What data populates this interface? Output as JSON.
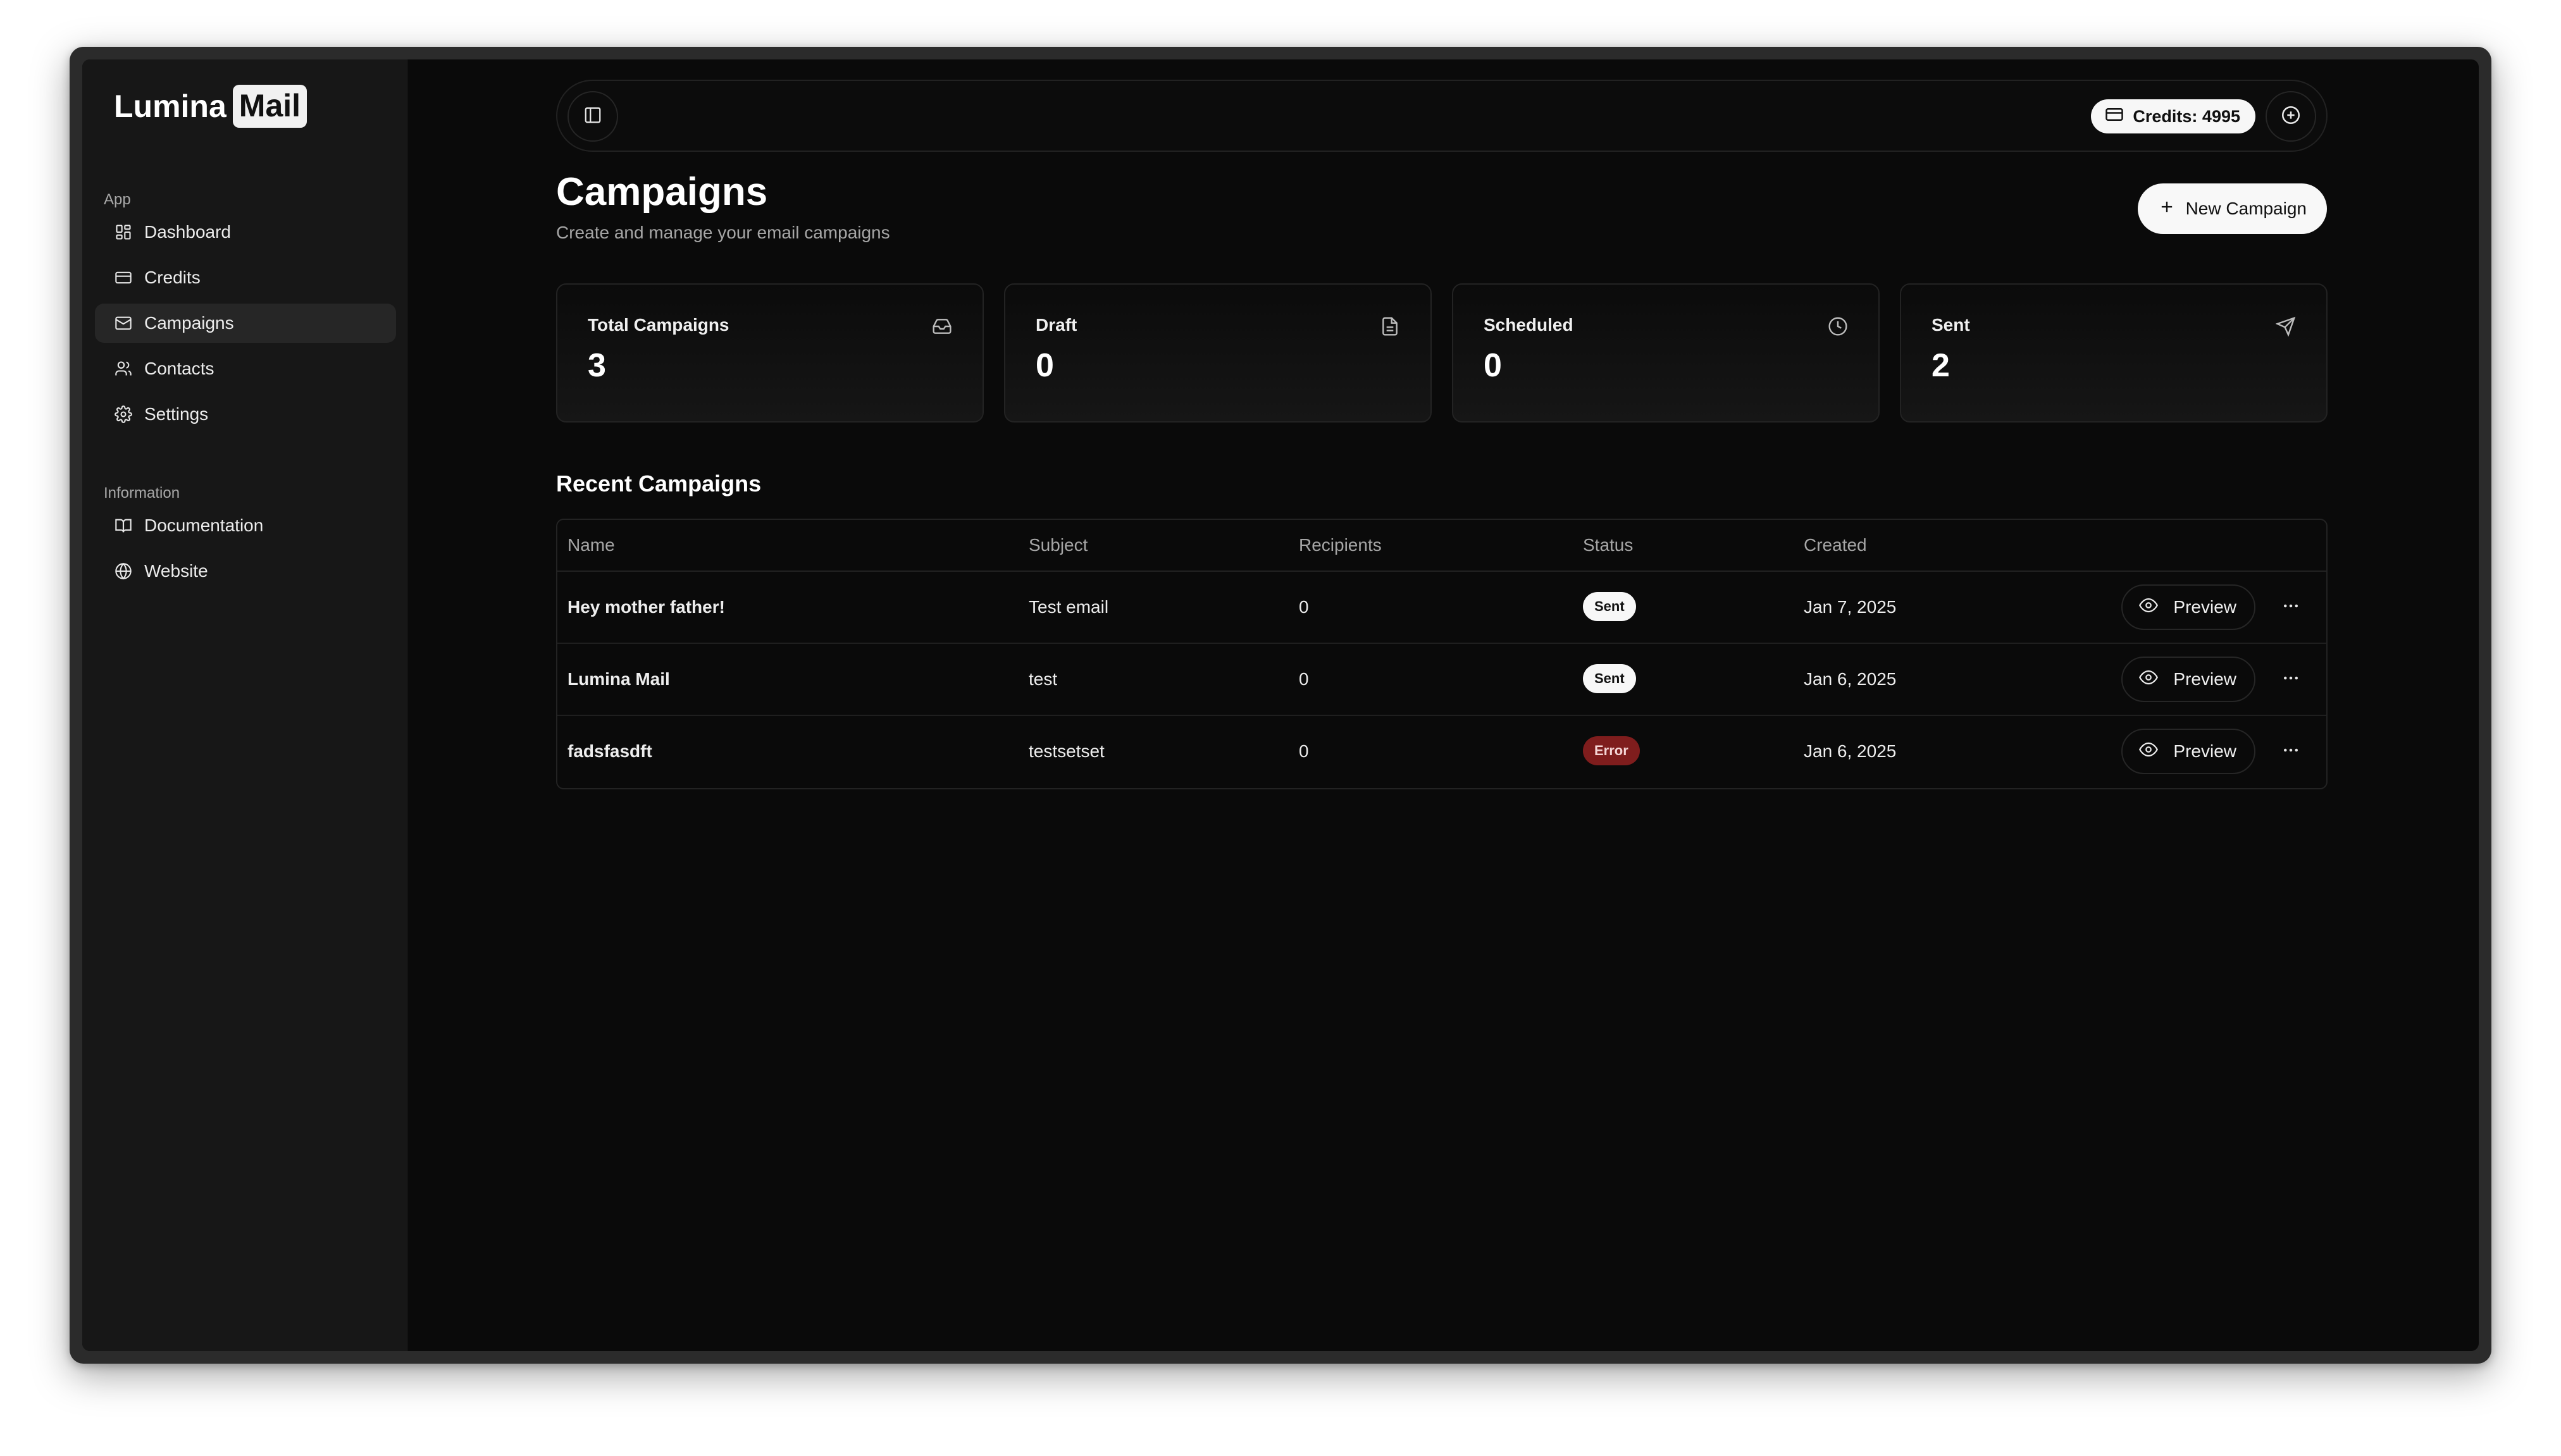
{
  "sidebar": {
    "logo_text": "Lumina",
    "logo_box": "Mail",
    "section_app": "App",
    "section_info": "Information",
    "app_items": [
      {
        "label": "Dashboard",
        "icon": "dashboard-icon"
      },
      {
        "label": "Credits",
        "icon": "credit-card-icon"
      },
      {
        "label": "Campaigns",
        "icon": "mail-icon",
        "active": true
      },
      {
        "label": "Contacts",
        "icon": "users-icon"
      },
      {
        "label": "Settings",
        "icon": "gear-icon"
      }
    ],
    "info_items": [
      {
        "label": "Documentation",
        "icon": "book-icon"
      },
      {
        "label": "Website",
        "icon": "globe-icon"
      }
    ]
  },
  "topbar": {
    "credits_label": "Credits: 4995"
  },
  "header": {
    "title": "Campaigns",
    "subtitle": "Create and manage your email campaigns",
    "new_button": "New Campaign"
  },
  "stats": [
    {
      "label": "Total Campaigns",
      "value": "3",
      "icon": "inbox-icon"
    },
    {
      "label": "Draft",
      "value": "0",
      "icon": "file-icon"
    },
    {
      "label": "Scheduled",
      "value": "0",
      "icon": "clock-icon"
    },
    {
      "label": "Sent",
      "value": "2",
      "icon": "send-icon"
    }
  ],
  "recent": {
    "title": "Recent Campaigns",
    "columns": [
      "Name",
      "Subject",
      "Recipients",
      "Status",
      "Created"
    ],
    "preview_label": "Preview",
    "rows": [
      {
        "name": "Hey mother father!",
        "subject": "Test email",
        "recipients": "0",
        "status": "Sent",
        "created": "Jan 7, 2025"
      },
      {
        "name": "Lumina Mail",
        "subject": "test",
        "recipients": "0",
        "status": "Sent",
        "created": "Jan 6, 2025"
      },
      {
        "name": "fadsfasdft",
        "subject": "testsetset",
        "recipients": "0",
        "status": "Error",
        "created": "Jan 6, 2025"
      }
    ]
  },
  "colors": {
    "background": "#0a0a0a",
    "sidebar": "#171717",
    "error_badge": "#7f1d1d",
    "sent_badge": "#f7f7f7"
  }
}
